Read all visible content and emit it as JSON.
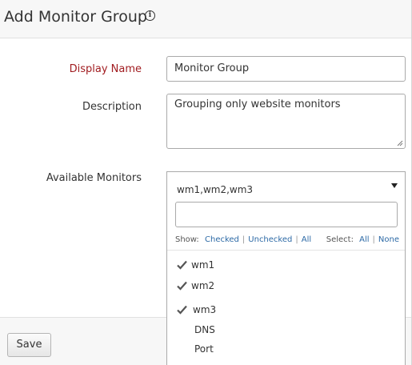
{
  "header": {
    "title": "Add Monitor Group",
    "info_icon": "info-icon"
  },
  "form": {
    "display_name": {
      "label": "Display Name",
      "value": "Monitor Group",
      "required_color": "#a11d21"
    },
    "description": {
      "label": "Description",
      "value": "Grouping only website monitors"
    },
    "available_monitors": {
      "label": "Available Monitors",
      "selected_summary": "wm1,wm2,wm3",
      "search_placeholder": "",
      "show_label": "Show:",
      "show_options": [
        "Checked",
        "Unchecked",
        "All"
      ],
      "select_label": "Select:",
      "select_options": [
        "All",
        "None"
      ],
      "options": [
        {
          "label": "wm1",
          "checked": true
        },
        {
          "label": "wm2",
          "checked": true
        },
        {
          "label": "wm3",
          "checked": true
        },
        {
          "label": "DNS",
          "checked": false
        },
        {
          "label": "Port",
          "checked": false
        }
      ]
    }
  },
  "footer": {
    "save_label": "Save"
  },
  "colors": {
    "link": "#2d6aa6",
    "header_bg": "#f7f7f7"
  }
}
